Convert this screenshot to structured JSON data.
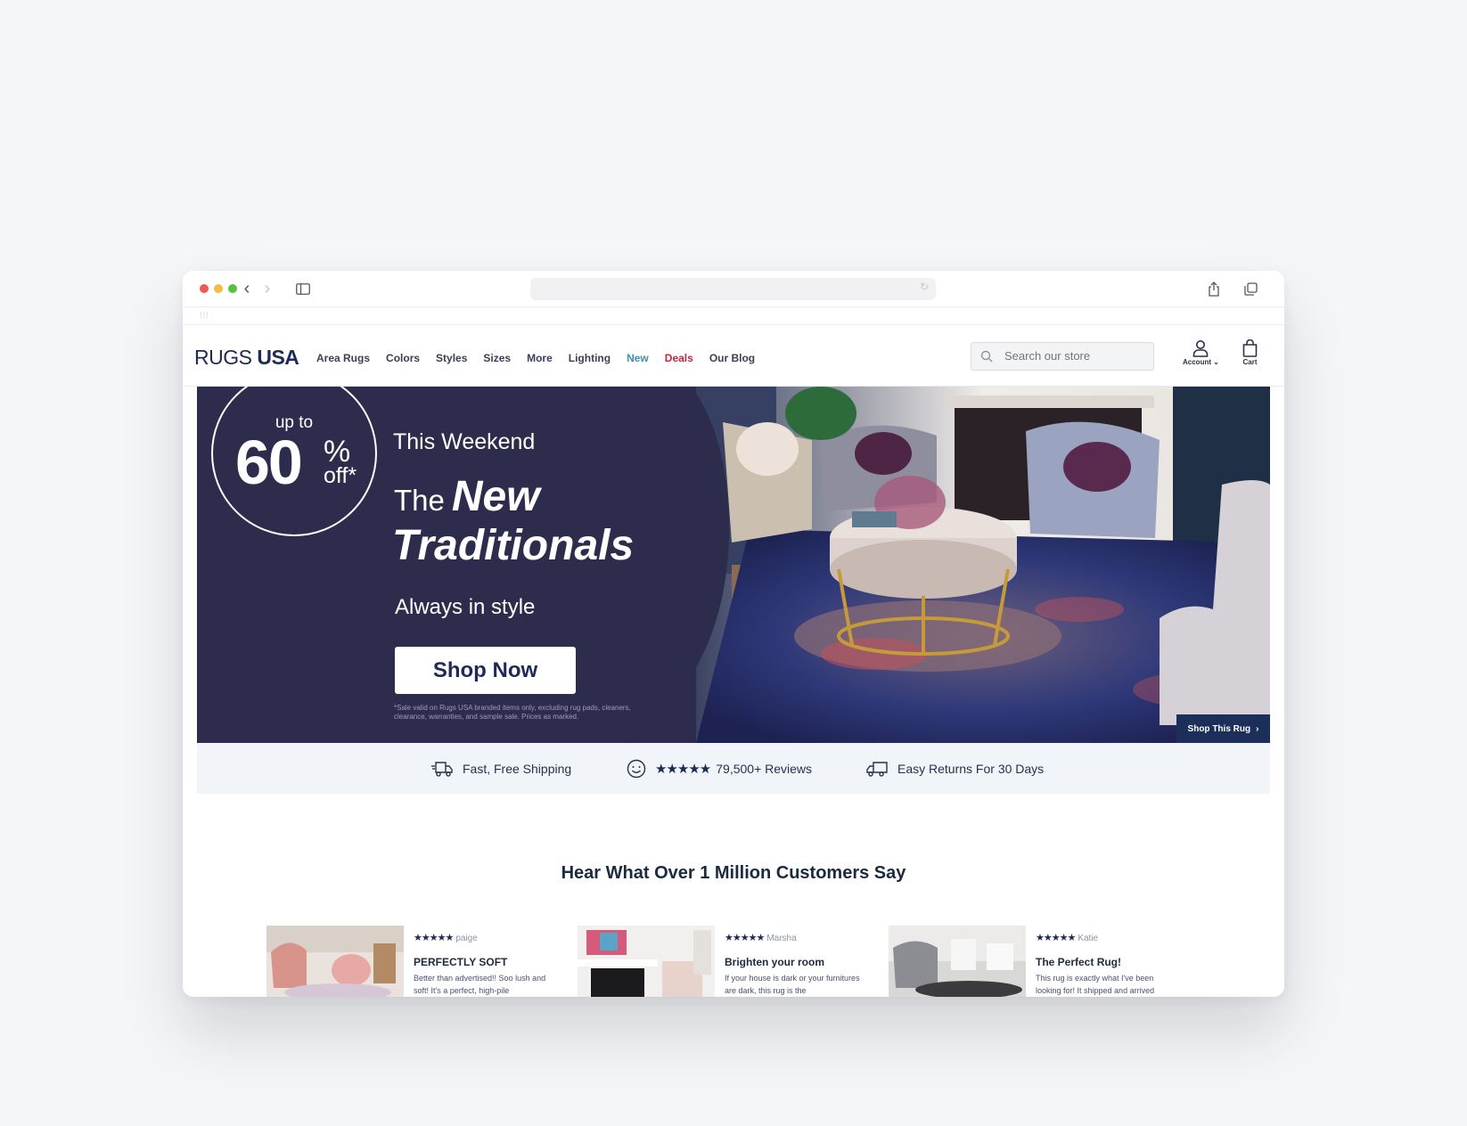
{
  "browser": {
    "nav_back": "‹",
    "nav_forward": "›",
    "reload": "↻"
  },
  "site": {
    "logo_light": "RUGS ",
    "logo_bold": "USA",
    "nav": [
      "Area Rugs",
      "Colors",
      "Styles",
      "Sizes",
      "More",
      "Lighting",
      "New",
      "Deals",
      "Our Blog"
    ],
    "nav_colors": {
      "New": "#3e8fb0",
      "Deals": "#c0283d"
    },
    "search_placeholder": "Search our store",
    "account_label": "Account",
    "cart_label": "Cart"
  },
  "hero": {
    "badge_upto": "up to",
    "badge_number": "60",
    "badge_percent": "%",
    "badge_off": "off*",
    "kicker": "This Weekend",
    "title_the": "The",
    "title_new": "New",
    "title_traditionals": "Traditionals",
    "subtitle": "Always in style",
    "cta": "Shop Now",
    "disclaimer": "*Sale valid on Rugs USA branded items only, excluding rug pads, cleaners, clearance, warranties, and sample sale. Prices as marked.",
    "shop_rug": "Shop This Rug",
    "panel_color": "#2e2c4c"
  },
  "features": {
    "shipping": "Fast, Free Shipping",
    "stars": "★★★★★",
    "reviews": "79,500+ Reviews",
    "returns": "Easy Returns For 30 Days"
  },
  "testimonials": {
    "title": "Hear What Over 1 Million Customers Say",
    "items": [
      {
        "stars": "★★★★★",
        "author": "paige",
        "title": "PERFECTLY SOFT",
        "body": "Better than advertised!! Soo lush and soft! It's a perfect, high-pile"
      },
      {
        "stars": "★★★★★",
        "author": "Marsha",
        "title": "Brighten your room",
        "body": "If your house is dark or your furnitures are dark, this rug is the"
      },
      {
        "stars": "★★★★★",
        "author": "Katie",
        "title": "The Perfect Rug!",
        "body": "This rug is exactly what I've been looking for! It shipped and arrived"
      }
    ]
  }
}
